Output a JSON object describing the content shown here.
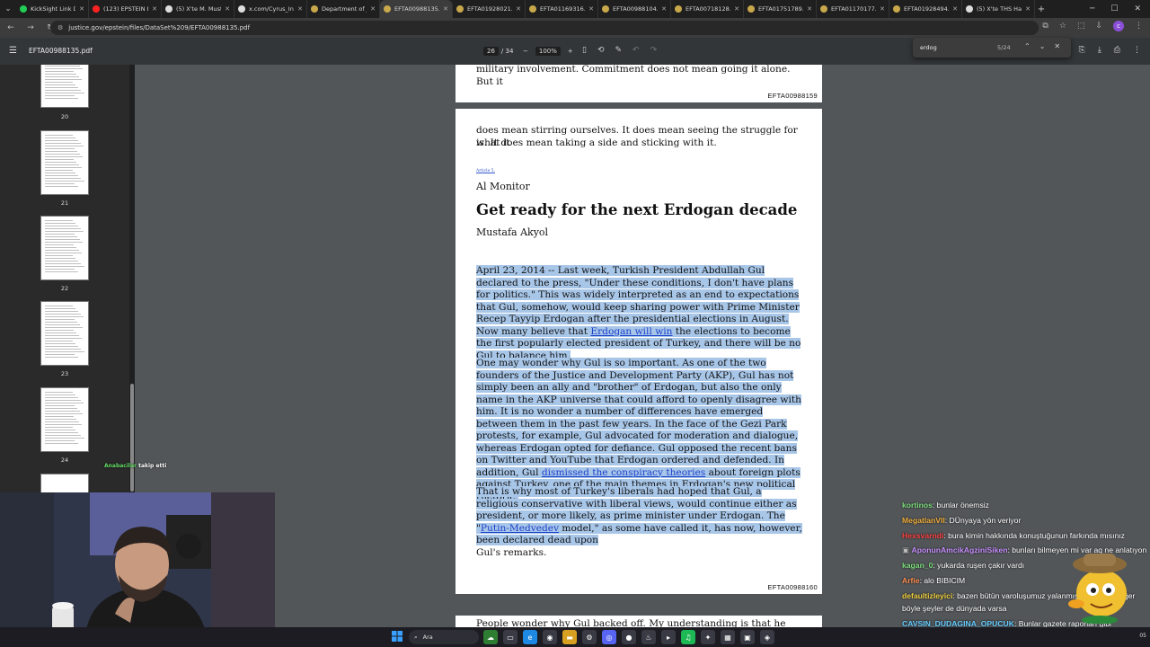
{
  "browser": {
    "tabs": [
      {
        "label": "KickSight Link De",
        "color": "#22cc55",
        "active": false
      },
      {
        "label": "(123) EPSTEIN DO",
        "color": "#ff2222",
        "active": false
      },
      {
        "label": "(5) X'te M. Musta",
        "color": "#dddddd",
        "active": false
      },
      {
        "label": "x.com/Cyrus_Inte",
        "color": "#dddddd",
        "active": false
      },
      {
        "label": "Department of Ju",
        "color": "#c8a84b",
        "active": false
      },
      {
        "label": "EFTA00988135.pd",
        "color": "#c8a84b",
        "active": true
      },
      {
        "label": "EFTA01928021.pd",
        "color": "#c8a84b",
        "active": false
      },
      {
        "label": "EFTA01169316.pd",
        "color": "#c8a84b",
        "active": false
      },
      {
        "label": "EFTA00988104.pd",
        "color": "#c8a84b",
        "active": false
      },
      {
        "label": "EFTA00718128.pd",
        "color": "#c8a84b",
        "active": false
      },
      {
        "label": "EFTA01751789.pd",
        "color": "#c8a84b",
        "active": false
      },
      {
        "label": "EFTA01170177.pd",
        "color": "#c8a84b",
        "active": false
      },
      {
        "label": "EFTA01928494.pd",
        "color": "#c8a84b",
        "active": false
      },
      {
        "label": "(5) X'te THS Habe",
        "color": "#dddddd",
        "active": false
      }
    ],
    "url": "justice.gov/epstein/files/DataSet%209/EFTA00988135.pdf",
    "profile_initial": "c"
  },
  "pdf": {
    "filename": "EFTA00988135.pdf",
    "current_page": "26",
    "total_pages": "/ 34",
    "zoom": "100%"
  },
  "find": {
    "query": "erdog",
    "count": "5/24"
  },
  "thumbnails": [
    {
      "num": "20"
    },
    {
      "num": "21"
    },
    {
      "num": "22"
    },
    {
      "num": "23"
    },
    {
      "num": "24"
    }
  ],
  "page_top": {
    "tail_line": "military involvement. Commitment does not mean going it alone. But it",
    "footer": "EFTA00988159"
  },
  "page_main": {
    "intro_line1": "does mean stirring ourselves. It does mean seeing the struggle for what it",
    "intro_line2": "is. It does mean taking a side and sticking with it.",
    "article_link": "Article 5.",
    "publication": "Al Monitor",
    "headline": "Get ready for the next Erdogan decade",
    "author": "Mustafa Akyol",
    "p1_a": "April 23, 2014 -- Last week, Turkish President Abdullah Gul declared to the press, \"Under these conditions, I don't have plans for politics.\" This was widely interpreted as an end to expectations that Gul, somehow, would keep sharing power with Prime Minister Recep Tayyip Erdogan after the presidential elections in August. Now many believe that ",
    "p1_link": "Erdogan will win",
    "p1_b": " the elections to become the first popularly elected president of Turkey, and there will be no Gul to balance him.",
    "p2_a": "One may wonder why Gul is so important. As one of the two founders of the Justice and Development Party (AKP), Gul has not simply been an ally and \"brother\" of Erdogan, but also the only name in the AKP universe that could afford to openly disagree with him. It is no wonder a number of differences have emerged between them in the past few years. In the face of the Gezi Park protests, for example, Gul advocated for moderation and dialogue, whereas Erdogan opted for defiance. Gul opposed the recent bans on Twitter and YouTube that Erdogan ordered and defended. In addition, Gul ",
    "p2_link": "dismissed the conspiracy theories",
    "p2_b": " about foreign plots against Turkey, one of the main themes in Erdogan's new political rhetoric.",
    "p3_a": "That is why most of Turkey's liberals had hoped that Gul, a religious conservative with liberal views, would continue either as president, or more likely, as prime minister under Erdogan. The \"",
    "p3_link": "Putin-Medvedev",
    "p3_b": " model,\" as some have called it, has now, however, been declared dead upon",
    "p3_c": "Gul's remarks.",
    "footer": "EFTA00988160"
  },
  "page_next": {
    "first_line": "People wonder why Gul backed off. My understanding is that he realized"
  },
  "follow_alert": {
    "user": "Anabacilar",
    "text": "takip etti"
  },
  "chat": [
    {
      "user": "kortinos",
      "color": "#7fe07f",
      "text": ": bunlar önemsiz"
    },
    {
      "user": "MegatlanVII",
      "color": "#f0b040",
      "text": ": DÜnyaya yön veriyor"
    },
    {
      "user": "Hexsvarndi",
      "color": "#ff4444",
      "text": ": bura kimin hakkında konuştuğunun farkında mısınız"
    },
    {
      "user": "AponunAmcikAgziniSiken",
      "color": "#c890ff",
      "text": ": bunları bilmeyen mi var aq ne anlatıyon"
    },
    {
      "user": "kagan_0",
      "color": "#7fe07f",
      "text": ": yukarda ruşen çakır vardı"
    },
    {
      "user": "Arfie",
      "color": "#ff9050",
      "text": ": alo BIBICIM"
    },
    {
      "user": "defaultizleyici",
      "color": "#f0d040",
      "text": ": bazen bütün varoluşumuz yalanmış gibi geliyor eğer böyle şeyler de dünyada varsa"
    },
    {
      "user": "CAVSIN_DUDAGINA_OPUCUK",
      "color": "#66ccff",
      "text": ": Bunlar gazete raporları gibi"
    }
  ],
  "taskbar": {
    "search_label": "Ara",
    "clock": "05"
  }
}
